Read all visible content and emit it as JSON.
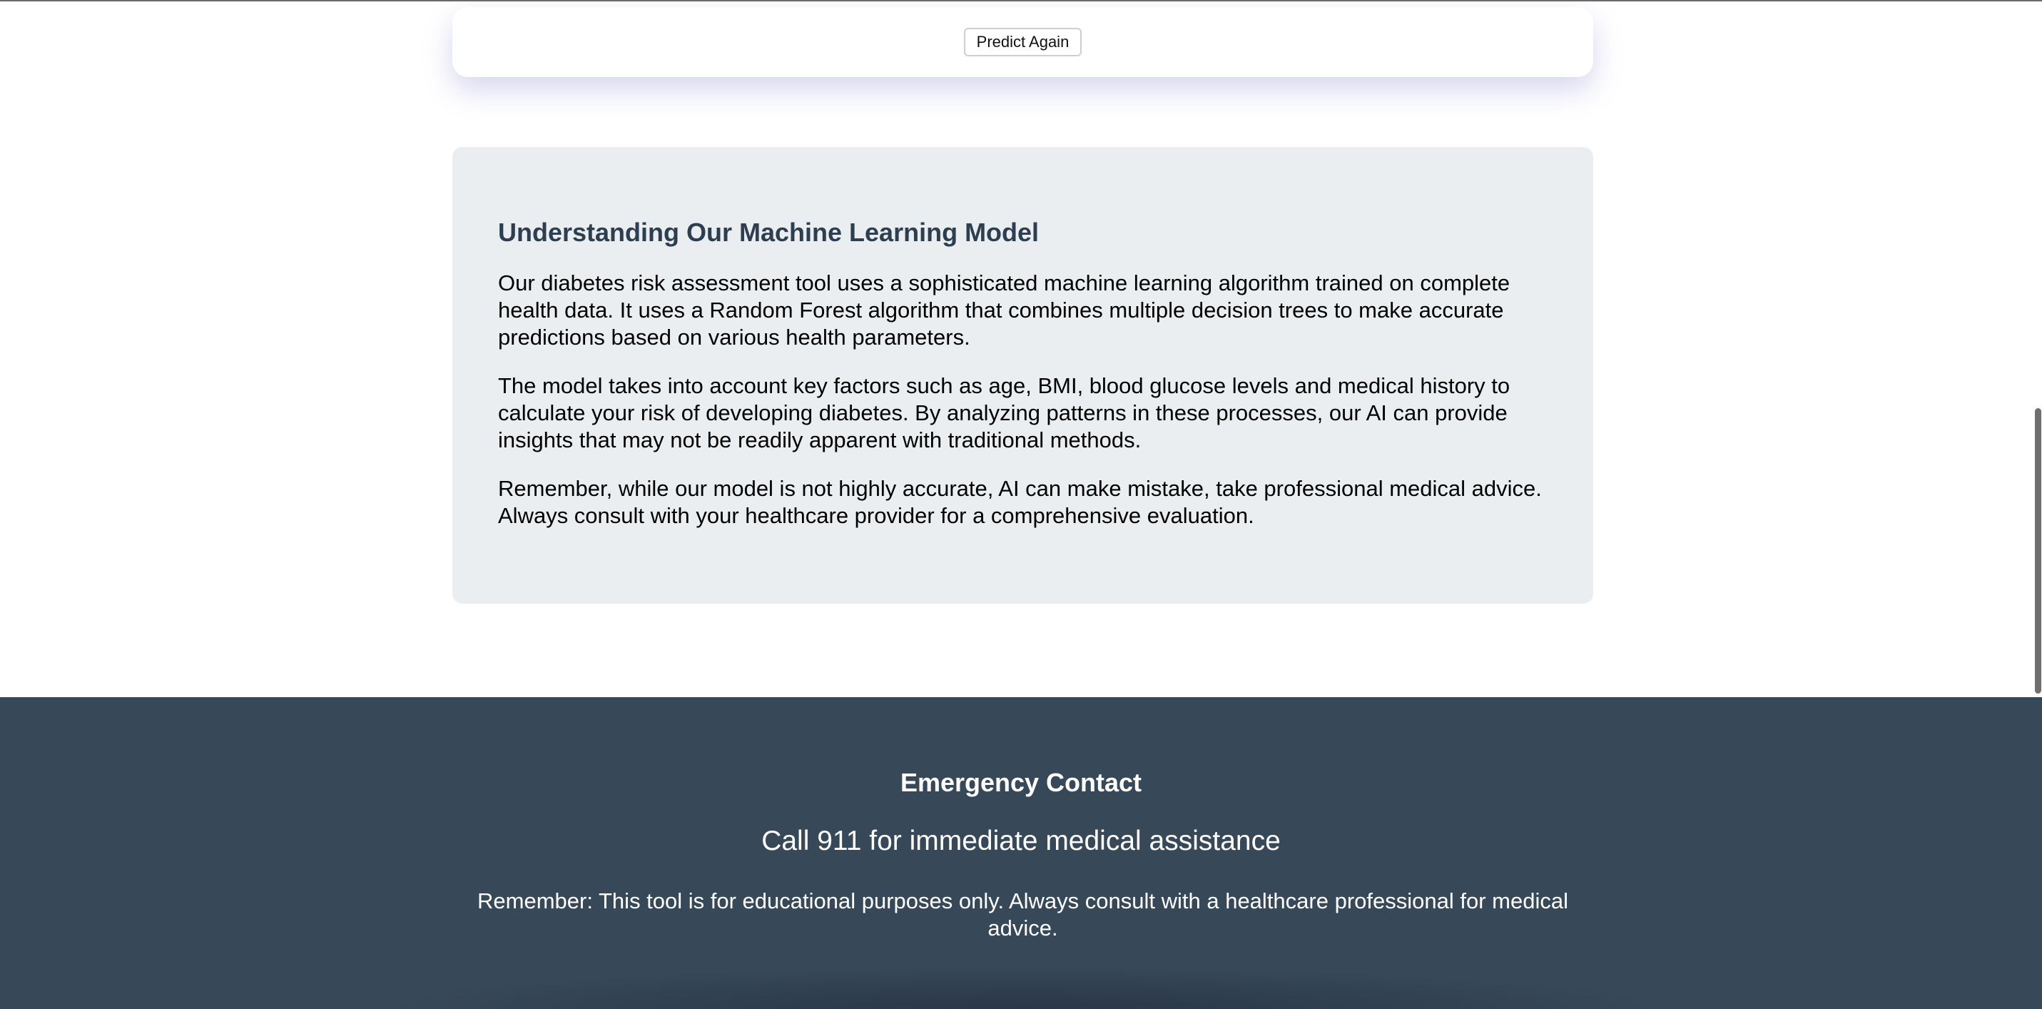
{
  "action": {
    "predict_again_label": "Predict Again"
  },
  "model_info": {
    "title": "Understanding Our Machine Learning Model",
    "paragraphs": [
      "Our diabetes risk assessment tool uses a sophisticated machine learning algorithm trained on complete health data. It uses a Random Forest algorithm that combines multiple decision trees to make accurate predictions based on various health parameters.",
      "The model takes into account key factors such as age, BMI, blood glucose levels and medical history to calculate your risk of developing diabetes. By analyzing patterns in these processes, our AI can provide insights that may not be readily apparent with traditional methods.",
      "Remember, while our model is not highly accurate, AI can make mistake, take professional medical advice. Always consult with your healthcare provider for a comprehensive evaluation."
    ]
  },
  "footer": {
    "heading": "Emergency Contact",
    "call_text": "Call 911 for immediate medical assistance",
    "disclaimer": "Remember: This tool is for educational purposes only. Always consult with a healthcare professional for medical advice."
  },
  "colors": {
    "info_card_bg": "#ebeef0",
    "title_color": "#2c3e50",
    "footer_bg": "#374859"
  }
}
